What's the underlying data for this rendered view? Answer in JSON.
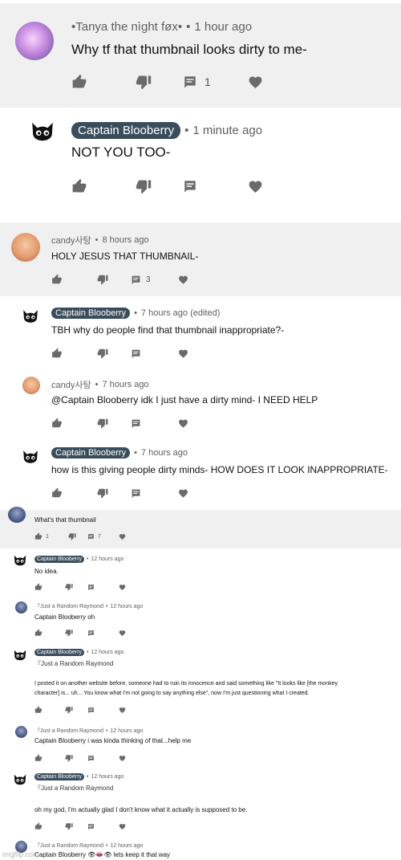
{
  "comments": [
    {
      "author": "•Tanya the nìght føx•",
      "time": "1 hour ago",
      "text": "Why tf that thumbnail looks dirty to me-",
      "reply_count": "1"
    },
    {
      "author": "Captain Blooberry",
      "time": "1 minute ago",
      "text": "NOT YOU TOO-"
    },
    {
      "author": "candy사탕",
      "time": "8 hours ago",
      "text": "HOLY JESUS THAT THUMBNAIL-",
      "reply_count": "3"
    },
    {
      "author": "Captain Blooberry",
      "time": "7 hours ago (edited)",
      "text": "TBH why do people find that thumbnail inappropriate?-"
    },
    {
      "author": "candy사탕",
      "time": "7 hours ago",
      "text": "@Captain Blooberry idk I just have a dirty mind- I NEED HELP"
    },
    {
      "author": "Captain Blooberry",
      "time": "7 hours ago",
      "text": "how is this giving people dirty minds- HOW DOES IT LOOK INAPPROPRIATE-"
    },
    {
      "text": "What's that thumbnail",
      "like_count": "1",
      "reply_count": "7"
    },
    {
      "author": "Captain Blooberry",
      "time": "12 hours ago",
      "text": "No idea."
    },
    {
      "author": "『Just a Random Raymond",
      "time": "12 hours ago",
      "text": "Captain Blooberry oh"
    },
    {
      "author": "Captain Blooberry",
      "time": "12 hours ago",
      "reply_to": "『Just a Random Raymond",
      "text_line1": "I posted it on another website before, someone had to ruin its innocence and said something like \"It looks like [the monkey",
      "text_line2": "character] is... uh... You know what I'm not going to say anything else\", now I'm just questioning what I created."
    },
    {
      "author": "『Just a Random Raymond",
      "time": "12 hours ago",
      "text": "Captain Blooberry i was kinda thinking of that...help me"
    },
    {
      "author": "Captain Blooberry",
      "time": "12 hours ago",
      "reply_to": "Just a Random Raymond",
      "text": "oh my god, I'm actually glad I don't know what it actually is supposed to be."
    },
    {
      "author": "『Just a Random Raymond",
      "time": "12 hours ago",
      "text": "Captain Blooberry 👁👄👁 lets keep it that way"
    }
  ],
  "watermark": "imgflip.com",
  "icons": {
    "like": "thumb-up-icon",
    "dislike": "thumb-down-icon",
    "reply": "reply-icon",
    "heart": "heart-icon"
  }
}
